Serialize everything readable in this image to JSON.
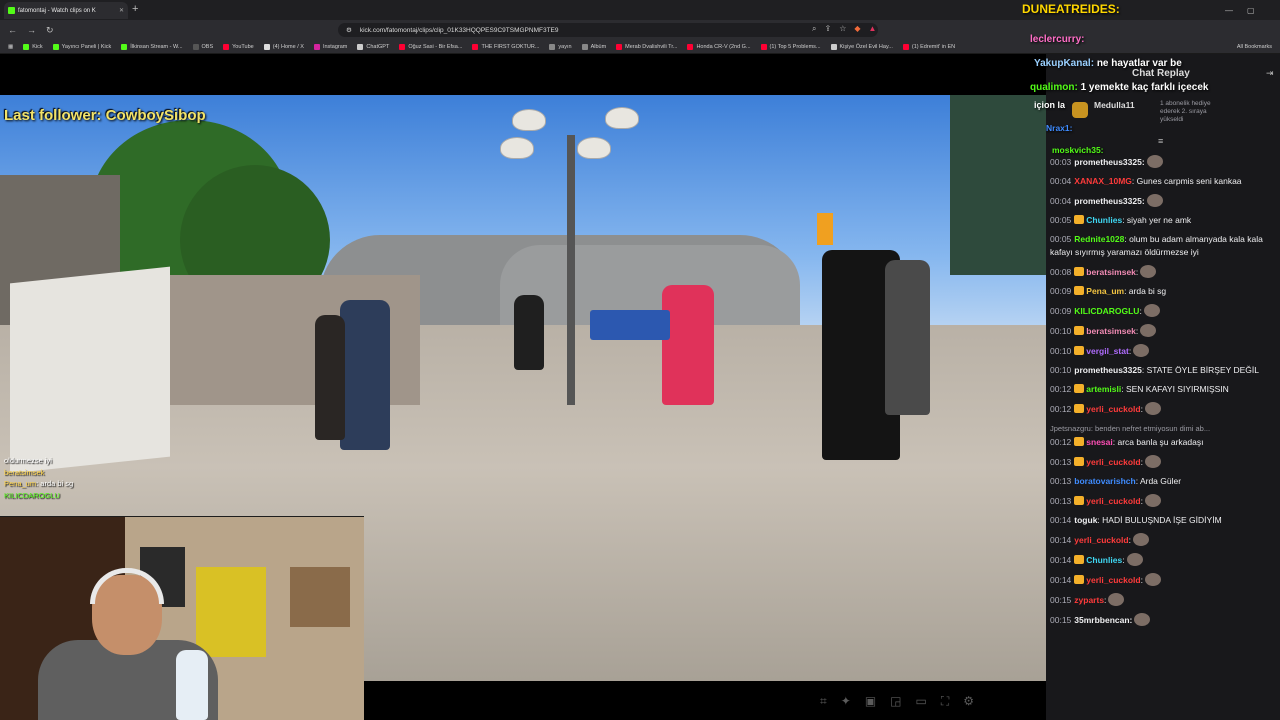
{
  "browser": {
    "tab_title": "fatomontaj - Watch clips on K",
    "new_tab": "+",
    "url": "kick.com/fatomontaj/clips/clip_01K33HQQPES9C9TSMGPNMF3TE9",
    "bookmarks": [
      {
        "label": "Kick",
        "color": "#53fc18"
      },
      {
        "label": "Yayıncı Paneli | Kick",
        "color": "#53fc18"
      },
      {
        "label": "İlkinsan Stream - W...",
        "color": "#53fc18"
      },
      {
        "label": "OBS",
        "color": "#555555"
      },
      {
        "label": "YouTube",
        "color": "#ff0033"
      },
      {
        "label": "(4) Home / X",
        "color": "#dddddd"
      },
      {
        "label": "Instagram",
        "color": "#d6249f"
      },
      {
        "label": "ChatGPT",
        "color": "#cccccc"
      },
      {
        "label": "Oğuz Sasi - Bir Efsa...",
        "color": "#ff0033"
      },
      {
        "label": "THE FIRST GOKTUR...",
        "color": "#ff0033"
      },
      {
        "label": "yayın",
        "color": "#888888"
      },
      {
        "label": "Albüm",
        "color": "#888888"
      },
      {
        "label": "Merab Dvalishvili Tr...",
        "color": "#ff0033"
      },
      {
        "label": "Honda CR-V (2nd G...",
        "color": "#ff0033"
      },
      {
        "label": "(1) Top 5 Problems...",
        "color": "#ff0033"
      },
      {
        "label": "Kişiye Özel Evil Hay...",
        "color": "#cccccc"
      },
      {
        "label": "(1) Edremit' in EN",
        "color": "#ff0033"
      }
    ],
    "all_bookmarks": "All Bookmarks"
  },
  "overlay": {
    "last_follower": "Last follower: CowboySibop",
    "mini_chat": [
      {
        "name": "",
        "text": "oldurmezse iyi"
      },
      {
        "name": "beratsimsek",
        "text": ""
      },
      {
        "name": "Pena_um",
        "text": ": arda bi sg"
      },
      {
        "name": "KILICDAROGLU",
        "text": ""
      }
    ]
  },
  "stream_overlay_top": {
    "line1_name": "DUNEATREIDES:",
    "line2_name": "leclercurry:",
    "line3_name": "YakupKanal:",
    "line3_text": "ne hayatlar var be",
    "chat_replay": "Chat Replay",
    "line4_name": "qualimon:",
    "line4_text": "1 yemekte kaç farklı içecek",
    "line4b": "içion la",
    "sub_name": "Medulla11",
    "sub_text": "1 abonelik hediye ederek 2. sıraya yükseldi",
    "line5_name": "Nrax1:",
    "line6_name": "moskvich35:"
  },
  "chat": [
    {
      "ts": "00:03",
      "name": "prometheus3325:",
      "color": "#efeff1",
      "text": ""
    },
    {
      "ts": "00:04",
      "name": "XANAX_10MG",
      "color": "#ff3b3b",
      "text": ": Gunes carpmis seni kankaa"
    },
    {
      "ts": "00:04",
      "name": "prometheus3325:",
      "color": "#efeff1",
      "text": ""
    },
    {
      "ts": "00:05",
      "name": "Chunlies",
      "color": "#3fd7f2",
      "text": ": siyah yer ne amk"
    },
    {
      "ts": "00:05",
      "name": "Rednite1028",
      "color": "#53fc18",
      "text": ": olum bu adam almanyada kala kala kafayı sıyırmış yaramazı öldürmezse iyi"
    },
    {
      "ts": "00:08",
      "name": "beratsimsek",
      "color": "#f18bb4",
      "text": ":"
    },
    {
      "ts": "00:09",
      "name": "Pena_um",
      "color": "#f4c542",
      "text": ": arda bi sg"
    },
    {
      "ts": "00:09",
      "name": "KILICDAROGLU",
      "color": "#53fc18",
      "text": ":"
    },
    {
      "ts": "00:10",
      "name": "beratsimsek",
      "color": "#f18bb4",
      "text": ":"
    },
    {
      "ts": "00:10",
      "name": "vergil_stat",
      "color": "#b06cff",
      "text": ":"
    },
    {
      "ts": "00:10",
      "name": "prometheus3325",
      "color": "#efeff1",
      "text": ": STATE ÖYLE BİRŞEY DEĞİL"
    },
    {
      "ts": "00:12",
      "name": "artemisli",
      "color": "#53fc18",
      "text": ": SEN KAFAYI SIYIRMIŞSIN"
    },
    {
      "ts": "00:12",
      "name": "yerli_cuckold",
      "color": "#ff3b3b",
      "text": ":"
    },
    {
      "reply": "Jpetsnazgru: benden nefret etmiyosun dimi ab..."
    },
    {
      "ts": "00:12",
      "name": "snesai",
      "color": "#ff4fb6",
      "text": ": arca banla şu arkadaşı"
    },
    {
      "ts": "00:13",
      "name": "yerli_cuckold",
      "color": "#ff3b3b",
      "text": ":"
    },
    {
      "ts": "00:13",
      "name": "boratovarishch",
      "color": "#3f8cff",
      "text": ": Arda Güler"
    },
    {
      "ts": "00:13",
      "name": "yerli_cuckold",
      "color": "#ff3b3b",
      "text": ":"
    },
    {
      "ts": "00:14",
      "name": "toguk",
      "color": "#efeff1",
      "text": ": HADİ BULUŞNDA İŞE GİDİYİM"
    },
    {
      "ts": "00:14",
      "name": "yerli_cuckold",
      "color": "#ff3b3b",
      "text": ":"
    },
    {
      "ts": "00:14",
      "name": "Chunlies",
      "color": "#3fd7f2",
      "text": ":"
    },
    {
      "ts": "00:14",
      "name": "yerli_cuckold",
      "color": "#ff3b3b",
      "text": ":"
    },
    {
      "ts": "00:15",
      "name": "zyparts",
      "color": "#ff3b3b",
      "text": ":"
    },
    {
      "ts": "00:15",
      "name": "35mrbbencan:",
      "color": "#efeff1",
      "text": ""
    }
  ]
}
